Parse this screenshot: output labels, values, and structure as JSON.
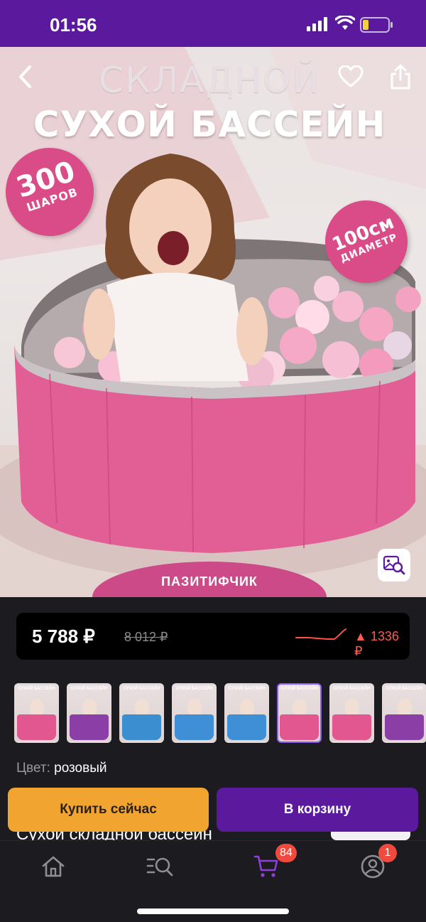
{
  "status_bar": {
    "time": "01:56"
  },
  "hero": {
    "title_line1": "СКЛАДНОЙ",
    "title_line2": "СУХОЙ БАССЕЙН",
    "badge_balls_number": "300",
    "badge_balls_label": "ШАРОВ",
    "badge_diameter_number": "100см",
    "badge_diameter_label": "ДИАМЕТР",
    "brand": "ПАЗИТИФЧИК"
  },
  "price": {
    "current": "5 788 ₽",
    "old": "8 012 ₽",
    "change": "▲ 1336 ₽"
  },
  "thumbnails": {
    "selected_index": 5,
    "items": [
      {
        "color": "#e2578f"
      },
      {
        "color": "#8b3fa6"
      },
      {
        "color": "#3b8ed0"
      },
      {
        "color": "#3f8fd6"
      },
      {
        "color": "#3f8fd6"
      },
      {
        "color": "#e2578f"
      },
      {
        "color": "#e2578f"
      },
      {
        "color": "#8b3fa6"
      }
    ]
  },
  "color": {
    "label": "Цвет:",
    "value": "розовый"
  },
  "actions": {
    "buy_now": "Купить сейчас",
    "add_to_cart": "В корзину"
  },
  "product_title_peek": "Сухой складной бассейн",
  "tabbar": {
    "cart_count": "84",
    "profile_count": "1"
  },
  "colors": {
    "status_bar": "#5b1a9e",
    "accent_orange": "#f2a431",
    "accent_purple": "#5b1a9e",
    "price_up": "#ff5a4e",
    "badge": "#ef4a3d"
  }
}
